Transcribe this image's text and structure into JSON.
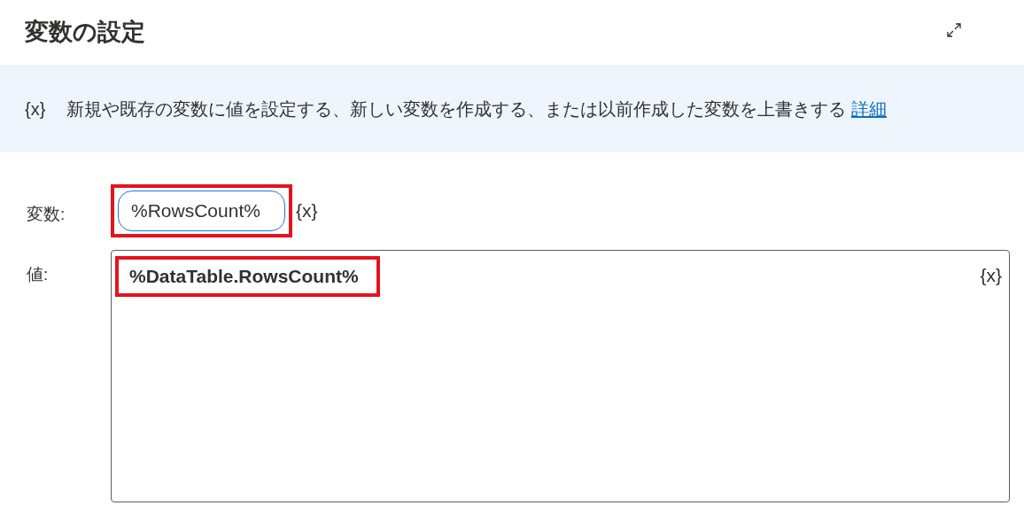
{
  "dialog": {
    "title": "変数の設定"
  },
  "info": {
    "icon_text": "{x}",
    "text": "新規や既存の変数に値を設定する、新しい変数を作成する、または以前作成した変数を上書きする",
    "link": "詳細"
  },
  "fields": [
    {
      "kind": "input",
      "label": "変数:",
      "value": "%RowsCount%",
      "focused": true,
      "highlighted": true,
      "insert_text": "{x}"
    },
    {
      "kind": "textarea",
      "label": "値:",
      "value": "%DataTable.RowsCount%",
      "focused": false,
      "highlighted": true,
      "insert_text": "{x}"
    }
  ]
}
